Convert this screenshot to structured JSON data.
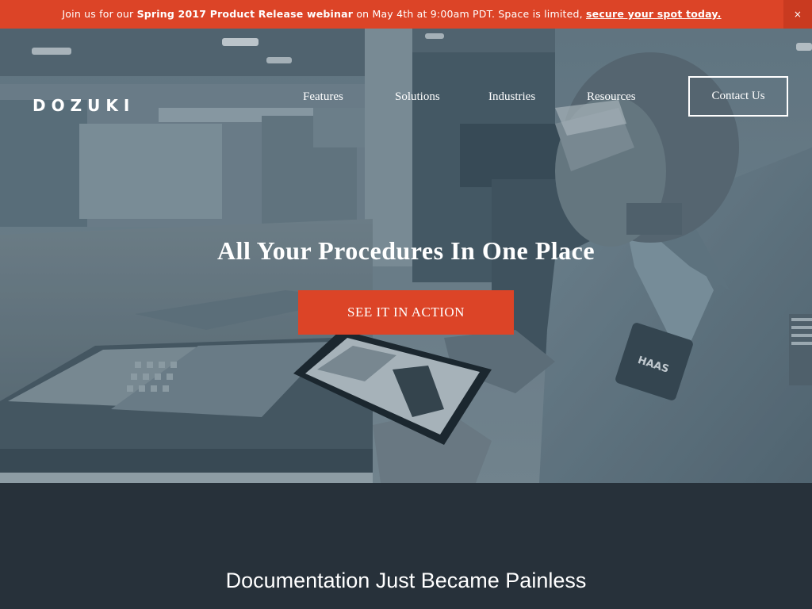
{
  "banner": {
    "text_before": "Join us for our ",
    "event_name": "Spring 2017 Product Release webinar",
    "text_middle": " on May 4th at 9:00am PDT. Space is limited, ",
    "link_text": "secure your spot today.",
    "close_label": "×"
  },
  "header": {
    "logo_text": "DOZUKI",
    "nav": [
      "Features",
      "Solutions",
      "Industries",
      "Resources"
    ],
    "contact_label": "Contact Us"
  },
  "hero": {
    "headline": "All Your Procedures In One Place",
    "cta_label": "SEE IT IN ACTION",
    "patch_text": "HAAS"
  },
  "section": {
    "title": "Documentation Just Became Painless"
  },
  "colors": {
    "accent": "#dc4427",
    "dark_background": "#27313a",
    "hero_tint": "#59707e"
  },
  "icons": [
    "close-icon"
  ]
}
